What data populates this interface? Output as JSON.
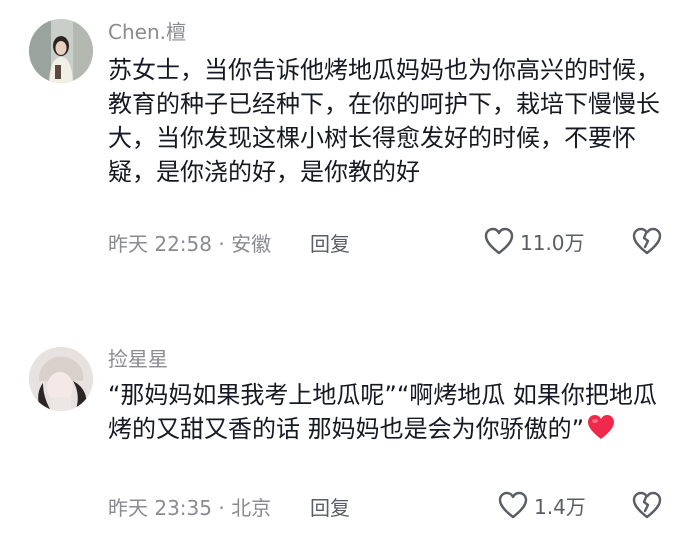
{
  "comments": [
    {
      "username": "Chen.檀",
      "text": "苏女士，当你告诉他烤地瓜妈妈也为你高兴的时候，教育的种子已经种下，在你的呵护下，栽培下慢慢长大，当你发现这棵小树长得愈发好的时候，不要怀疑，是你浇的好，是你教的好",
      "time_location": "昨天 22:58 · 安徽",
      "reply_label": "回复",
      "like_count": "11.0万",
      "avatar_icon": "user-avatar"
    },
    {
      "username": "捡星星",
      "text": "“那妈妈如果我考上地瓜呢”“啊烤地瓜 如果你把地瓜烤的又甜又香的话 那妈妈也是会为你骄傲的”",
      "emoji": "red-heart",
      "time_location": "昨天 23:35 · 北京",
      "reply_label": "回复",
      "like_count": "1.4万",
      "avatar_icon": "user-avatar"
    }
  ],
  "colors": {
    "text_primary": "#161823",
    "text_secondary": "#8a8b91",
    "action_text": "#5b5d66",
    "heart_red": "#fe2c55"
  }
}
